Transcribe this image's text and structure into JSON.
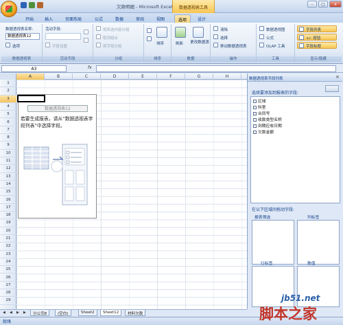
{
  "window": {
    "title": "欠款明细 - Microsoft Excel",
    "context_tab_group": "数据透视表工具",
    "win_buttons": [
      "-",
      "□",
      "x"
    ]
  },
  "tabs": [
    "开始",
    "插入",
    "页面布局",
    "公式",
    "数据",
    "审阅",
    "视图",
    "选项",
    "设计"
  ],
  "active_tab": "选项",
  "ribbon": {
    "pivot_group": {
      "label": "数据透视表",
      "name_label": "数据透视表名称:",
      "name_value": "数据透视表12",
      "options": "选项"
    },
    "active_field": {
      "label": "活动字段",
      "title": "活动字段:",
      "settings": "字段设置"
    },
    "group_group": {
      "label": "分组",
      "items": [
        "将所选内容分组",
        "取消组合",
        "将字段分组"
      ]
    },
    "sort_group": {
      "label": "排序",
      "sort": "排序"
    },
    "data_group": {
      "label": "数据",
      "refresh": "刷新",
      "change_source": "更改数据源"
    },
    "actions_group": {
      "label": "操作",
      "items": [
        "清除",
        "选择",
        "移动数据透视表"
      ]
    },
    "tools_group": {
      "label": "工具",
      "items": [
        "数据透视图",
        "公式",
        "OLAP 工具"
      ]
    },
    "show_hide_group": {
      "label": "显示/隐藏",
      "items": [
        "字段列表",
        "+/- 按钮",
        "字段标题"
      ]
    }
  },
  "formula_bar": {
    "name_box": "A3",
    "fx": "fx",
    "value": ""
  },
  "sheet": {
    "columns": [
      "A",
      "B",
      "C",
      "D",
      "E",
      "F",
      "G",
      "H"
    ],
    "rows": [
      "1",
      "2",
      "3",
      "4",
      "5",
      "6",
      "7",
      "8",
      "9",
      "10",
      "11",
      "12",
      "13",
      "14",
      "15",
      "16",
      "17",
      "18",
      "19",
      "20",
      "21",
      "22",
      "23",
      "24",
      "25",
      "26",
      "27",
      "28",
      "29"
    ],
    "selected_column": "A",
    "selected_row": "3",
    "pivot_placeholder_name": "数据透视表12",
    "pivot_hint": "若要生成报表，请从“数据透视表字段列表”中选择字段。"
  },
  "task_pane": {
    "title": "数据透视表字段列表",
    "choose_label": "选择要添加到报表的字段:",
    "fields": [
      "区域",
      "科室",
      "合同号",
      "收款类型名称",
      "到期应收日期",
      "欠款金额"
    ],
    "drag_label": "在以下区域间拖动字段:",
    "areas": {
      "report_filter": "报表筛选",
      "column_labels": "列标签",
      "row_labels": "行标签",
      "values": "数值"
    }
  },
  "sheet_tabs": [
    "分公司8",
    "(空白)",
    "Sheet2",
    "Sheet12",
    "材料欠款"
  ],
  "active_sheet_tab": "Sheet12",
  "status": {
    "text": "就绪"
  },
  "watermark": {
    "line1": "jb51.net",
    "line2": "脚本之家"
  }
}
